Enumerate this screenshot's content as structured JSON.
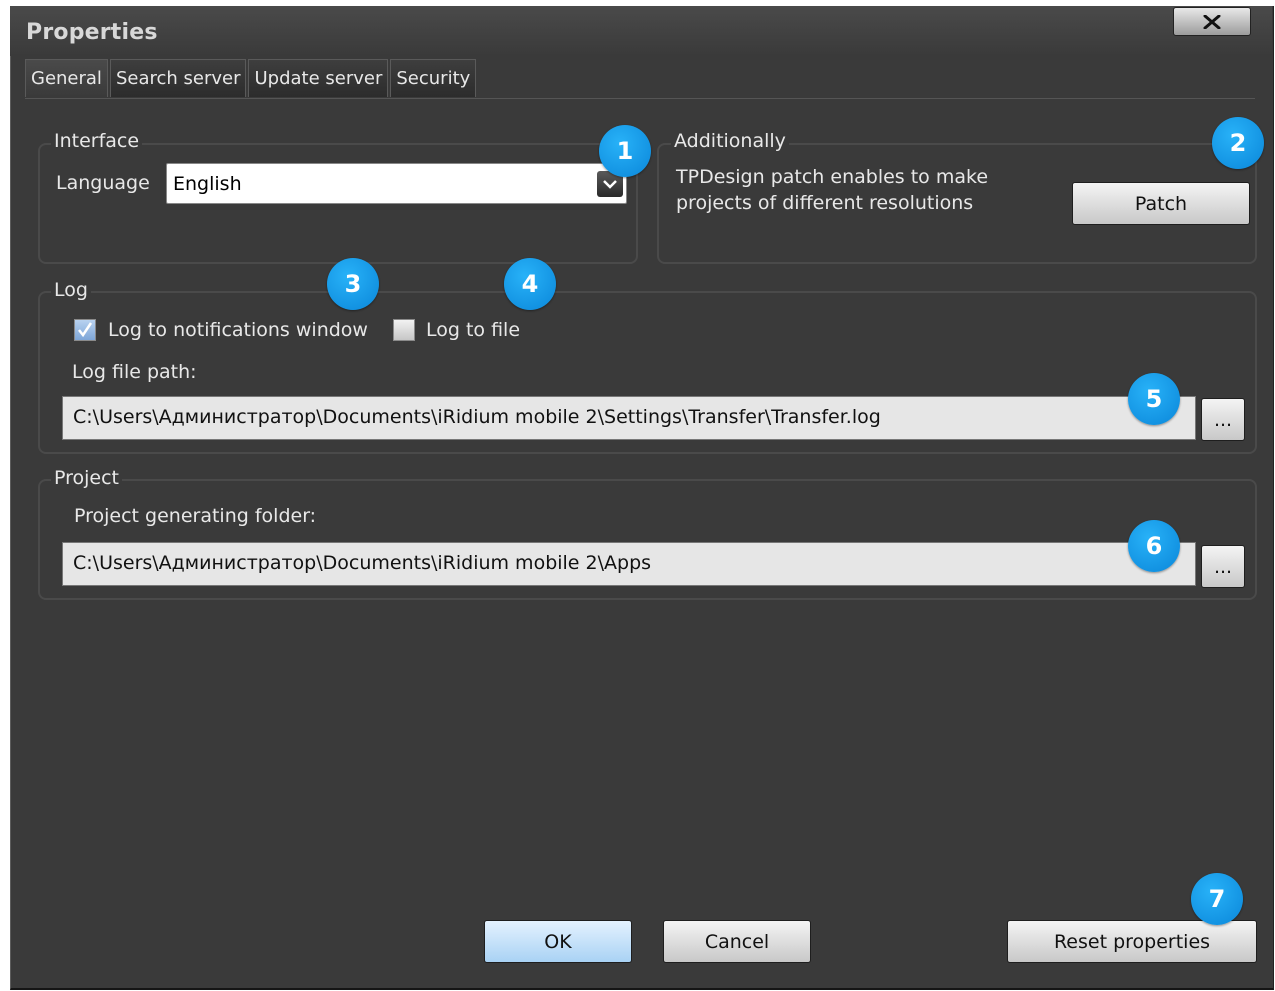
{
  "window": {
    "title": "Properties"
  },
  "tabs": [
    {
      "label": "General"
    },
    {
      "label": "Search server"
    },
    {
      "label": "Update server"
    },
    {
      "label": "Security"
    }
  ],
  "interface": {
    "group_title": "Interface",
    "language_label": "Language",
    "language_value": "English"
  },
  "additionally": {
    "group_title": "Additionally",
    "description_line1": "TPDesign patch enables to make",
    "description_line2": "projects of different resolutions",
    "patch_button": "Patch"
  },
  "log": {
    "group_title": "Log",
    "log_to_notifications_label": "Log to notifications window",
    "log_to_notifications_checked": true,
    "log_to_file_label": "Log to file",
    "log_to_file_checked": false,
    "path_label": "Log file path:",
    "path_value": "C:\\Users\\Администратор\\Documents\\iRidium mobile 2\\Settings\\Transfer\\Transfer.log",
    "browse_label": "..."
  },
  "project": {
    "group_title": "Project",
    "folder_label": "Project generating folder:",
    "folder_value": "C:\\Users\\Администратор\\Documents\\iRidium mobile 2\\Apps",
    "browse_label": "..."
  },
  "footer": {
    "ok_label": "OK",
    "cancel_label": "Cancel",
    "reset_label": "Reset properties"
  },
  "callouts": [
    "1",
    "2",
    "3",
    "4",
    "5",
    "6",
    "7"
  ],
  "colors": {
    "window_bg": "#3a3a3a",
    "callout_blue": "#0a86d9",
    "text": "#e8e8e8"
  }
}
